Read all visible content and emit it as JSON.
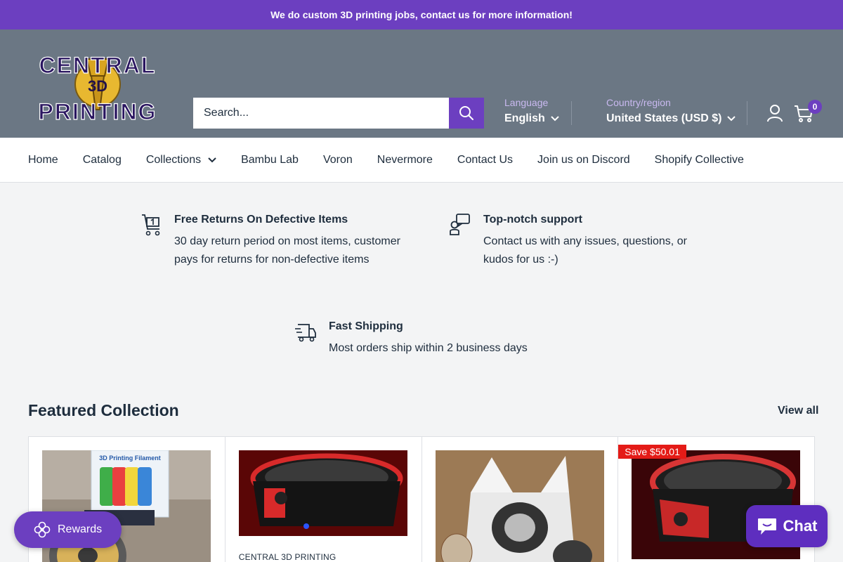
{
  "announcement": "We do custom 3D printing jobs, contact us for more information!",
  "logo": {
    "line1": "CENTRAL",
    "badge": "3D",
    "line2": "PRINTING"
  },
  "search": {
    "placeholder": "Search..."
  },
  "language": {
    "label": "Language",
    "value": "English"
  },
  "country": {
    "label": "Country/region",
    "value": "United States (USD $)"
  },
  "cart": {
    "count": "0"
  },
  "nav": [
    {
      "label": "Home"
    },
    {
      "label": "Catalog"
    },
    {
      "label": "Collections"
    },
    {
      "label": "Bambu Lab"
    },
    {
      "label": "Voron"
    },
    {
      "label": "Nevermore"
    },
    {
      "label": "Contact Us"
    },
    {
      "label": "Join us on Discord"
    },
    {
      "label": "Shopify Collective"
    }
  ],
  "features": [
    {
      "icon": "return-box-icon",
      "title": "Free Returns On Defective Items",
      "text": "30 day return period on most items, customer pays for returns for non-defective items"
    },
    {
      "icon": "support-agent-icon",
      "title": "Top-notch support",
      "text": "Contact us with any issues, questions, or kudos for us :-)"
    },
    {
      "icon": "delivery-truck-icon",
      "title": "Fast Shipping",
      "text": "Most orders ship within 2 business days"
    }
  ],
  "featured": {
    "title": "Featured Collection",
    "view_all": "View all",
    "products": [
      {
        "image": "filament-spool-photo",
        "image_text": "3D Printing Filament"
      },
      {
        "image": "red-black-filter-housing-render",
        "vendor": "CENTRAL 3D PRINTING"
      },
      {
        "image": "white-box-spool-photo"
      },
      {
        "image": "red-filter-housing-render",
        "badge": "Save $50.01"
      }
    ]
  },
  "rewards": {
    "label": "Rewards"
  },
  "chat": {
    "label": "Chat"
  },
  "colors": {
    "brand": "#6c3fc0",
    "header": "#6b7784",
    "sale": "#e41b17"
  }
}
